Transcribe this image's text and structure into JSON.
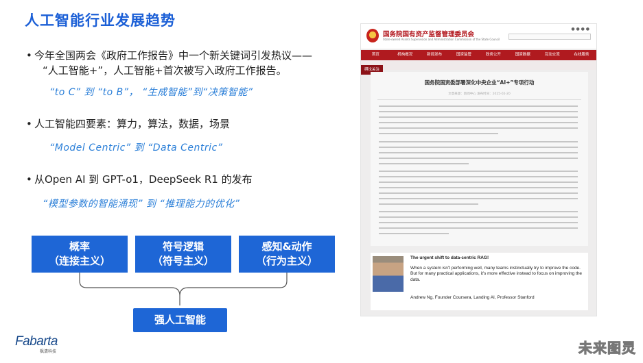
{
  "slide": {
    "title": "人工智能行业发展趋势",
    "bullets": [
      {
        "dot": "•",
        "line1": "今年全国两会《政府工作报告》中一个新关键词引发热议——",
        "line2": "“人工智能+”，人工智能+首次被写入政府工作报告。",
        "quote": "“to C”  到  “to B”，  “生成智能”到“决策智能”"
      },
      {
        "dot": "•",
        "line1": "人工智能四要素：算力，算法，数据，场景",
        "quote": "“Model Centric”  到  “Data Centric”"
      },
      {
        "dot": "•",
        "line1": "从Open AI 到 GPT-o1，DeepSeek R1 的发布",
        "quote": "“模型参数的智能涌现”  到  “推理能力的优化”"
      }
    ],
    "boxes": [
      {
        "line1": "概率",
        "line2": "（连接主义）"
      },
      {
        "line1": "符号逻辑",
        "line2": "（符号主义）"
      },
      {
        "line1": "感知&动作",
        "line2": "（行为主义）"
      }
    ],
    "main_box": "强人工智能",
    "accent_color": "#1e66d6"
  },
  "document": {
    "org_name": "国务院国有资产监督管理委员会",
    "org_name_en": "State-owned Assets Supervision and Administration Commission of the State Council",
    "nav": [
      "首页",
      "机构概况",
      "新闻发布",
      "国资监管",
      "政务公开",
      "国资数据",
      "互动交流",
      "在线服务"
    ],
    "sub_nav": "舆论关注",
    "title": "国务院国资委部署深化中央企业“AI+”专项行动",
    "meta": "文章来源：新闻中心    发布时间：2025-02-20"
  },
  "card": {
    "headline": "The urgent shift to data-centric RAG!",
    "quote": "When a system isn't performing well, many teams instinctually try to improve the code. But for many practical applications, it's more effective instead to focus on improving the data.",
    "author": "Andrew Ng, Founder Coursera, Landing AI, Professor Stanford"
  },
  "footer": {
    "logo": "Fabarta",
    "logo_sub": "枫清科技",
    "watermark": "未来图灵"
  }
}
